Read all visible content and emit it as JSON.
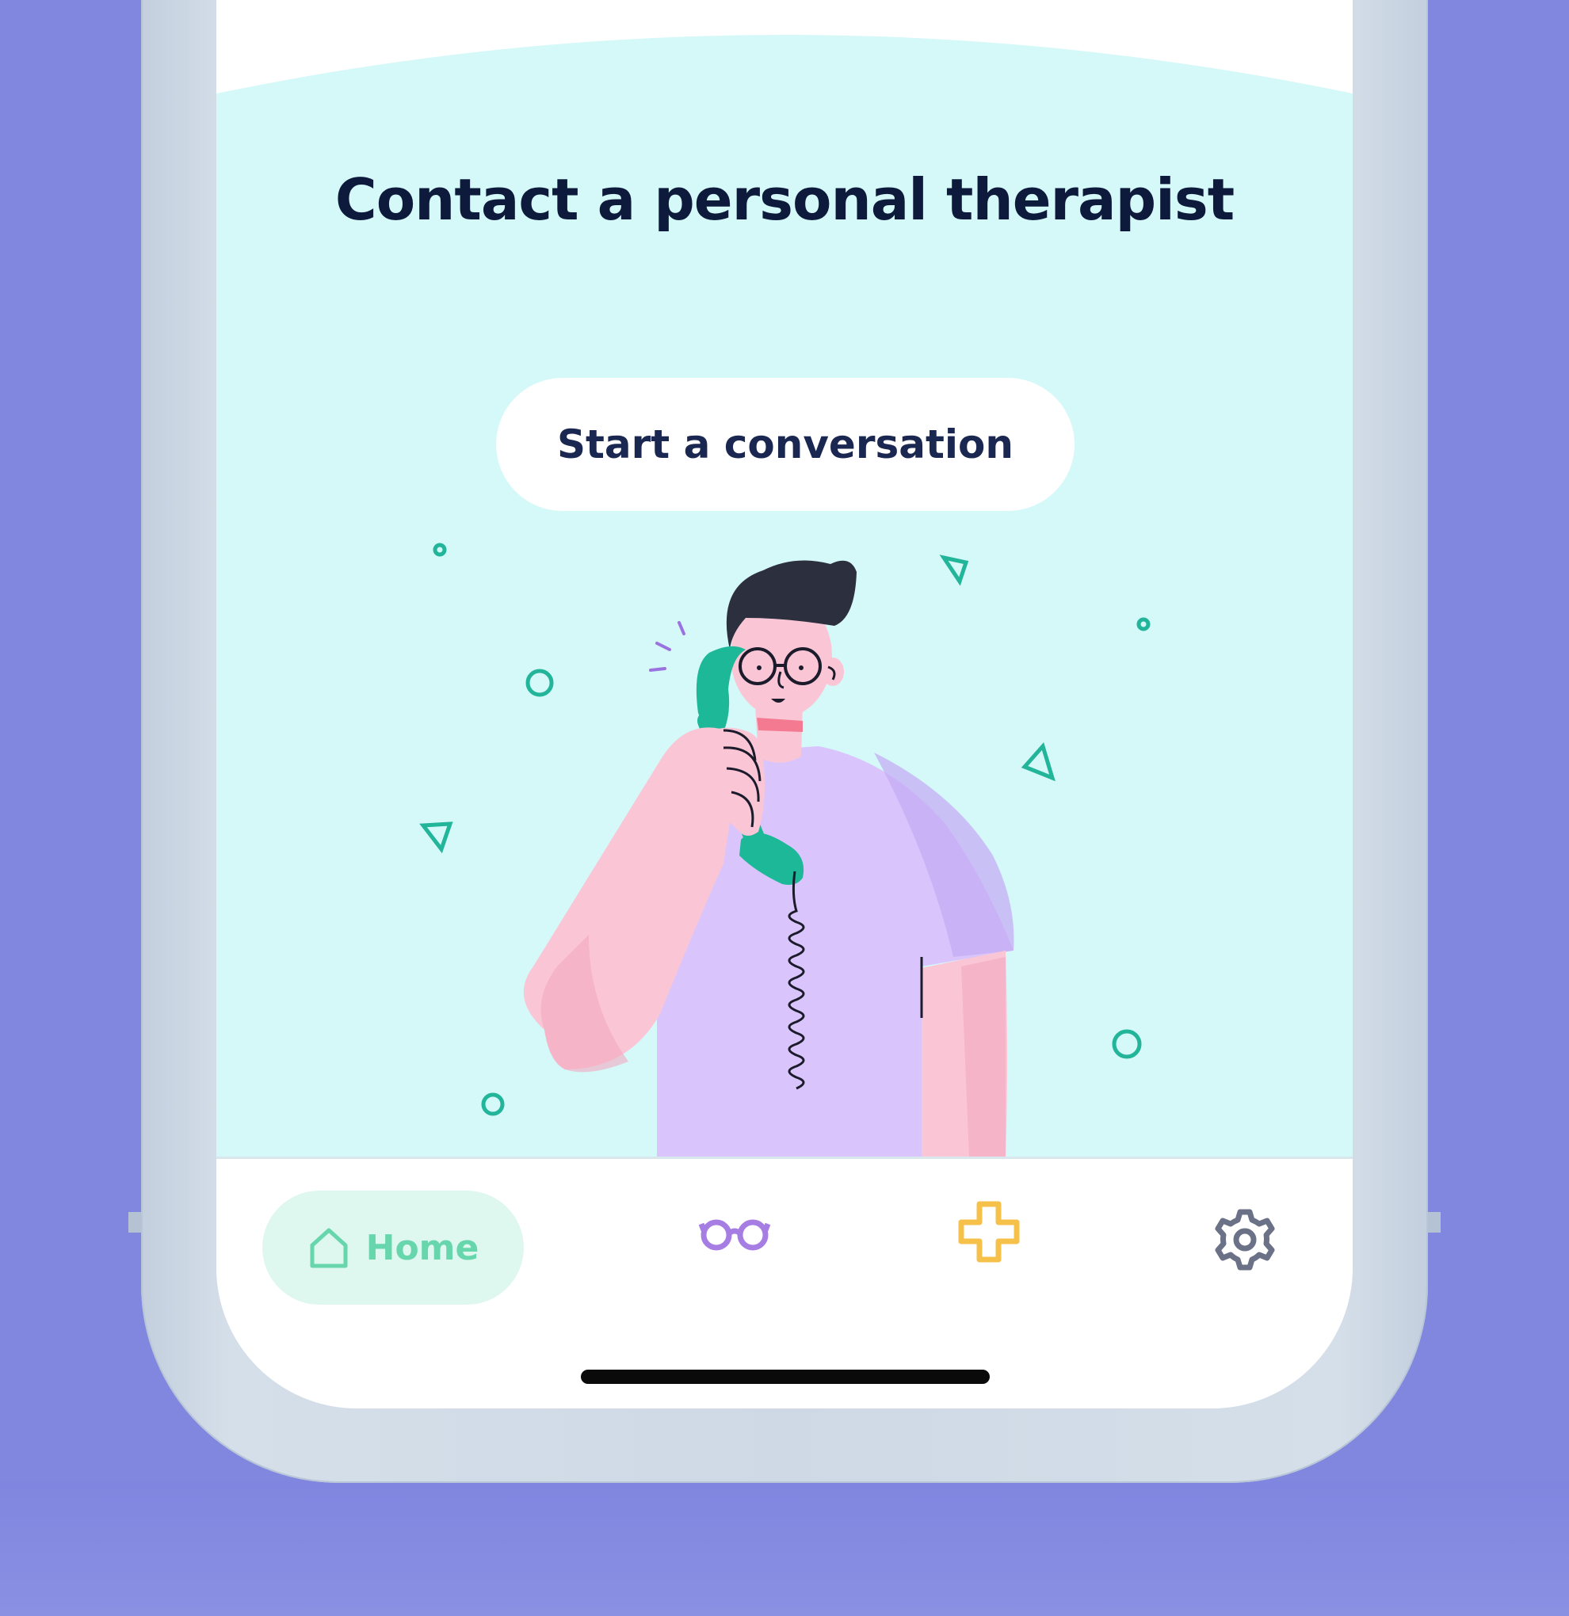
{
  "colors": {
    "background": "#8187df",
    "hero_background": "#d5f8f8",
    "title": "#0d1a3b",
    "home_tab_bg": "#def7ef",
    "home_tab_fg": "#67d6ad",
    "glasses_icon": "#a67ee3",
    "plus_icon": "#f6c14a",
    "gear_icon": "#6b7186"
  },
  "hero": {
    "title": "Contact a personal therapist",
    "cta_label": "Start a conversation"
  },
  "tabbar": {
    "home": {
      "label": "Home",
      "icon": "house-icon"
    },
    "tabs": [
      {
        "icon": "glasses-icon"
      },
      {
        "icon": "plus-icon"
      },
      {
        "icon": "gear-icon"
      }
    ]
  }
}
